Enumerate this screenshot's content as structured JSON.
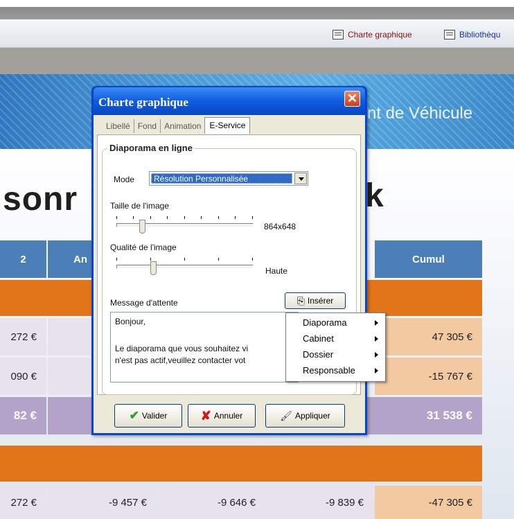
{
  "toolbar_links": [
    {
      "label": "Charte graphique",
      "icon": "settings-window-icon"
    },
    {
      "label": "Bibliothèqu",
      "icon": "library-icon"
    }
  ],
  "banner": {
    "text": "nt de Véhicule"
  },
  "page": {
    "title_left": "sonr",
    "title_right": "k"
  },
  "table": {
    "headers": [
      "2",
      "An",
      "Cumul"
    ],
    "rows": [
      {
        "c1": "272 €",
        "c_cumul": "47 305 €"
      },
      {
        "c1": "090 €",
        "c_cumul": "-15 767 €"
      },
      {
        "c1": "82 €",
        "c_cumul": "31 538 €"
      }
    ],
    "bottom_row": [
      "272 €",
      "-9 457 €",
      "-9 646 €",
      "-9 839 €",
      "-47 305 €"
    ]
  },
  "dialog": {
    "title": "Charte graphique",
    "tabs": [
      "Libellé",
      "Fond",
      "Animation",
      "E-Service"
    ],
    "active_tab": "E-Service",
    "group_title": "Diaporama en ligne",
    "mode_label": "Mode",
    "mode_value": "Résolution Personnalisée",
    "size_label": "Taille de l'image",
    "size_value": "864x648",
    "size_level": 0.17,
    "quality_label": "Qualité de l'image",
    "quality_value": "Haute",
    "quality_level": 0.25,
    "message_label": "Message d'attente",
    "insert_button": "Insérer",
    "message_lines": [
      "Bonjour,",
      "",
      "Le diaporama que vous souhaitez vi",
      "n'est pas actif,veuillez contacter vot"
    ],
    "buttons": {
      "ok": "Valider",
      "cancel": "Annuler",
      "apply": "Appliquer"
    }
  },
  "context_menu": {
    "items": [
      "Diaporama",
      "Cabinet",
      "Dossier",
      "Responsable"
    ]
  }
}
